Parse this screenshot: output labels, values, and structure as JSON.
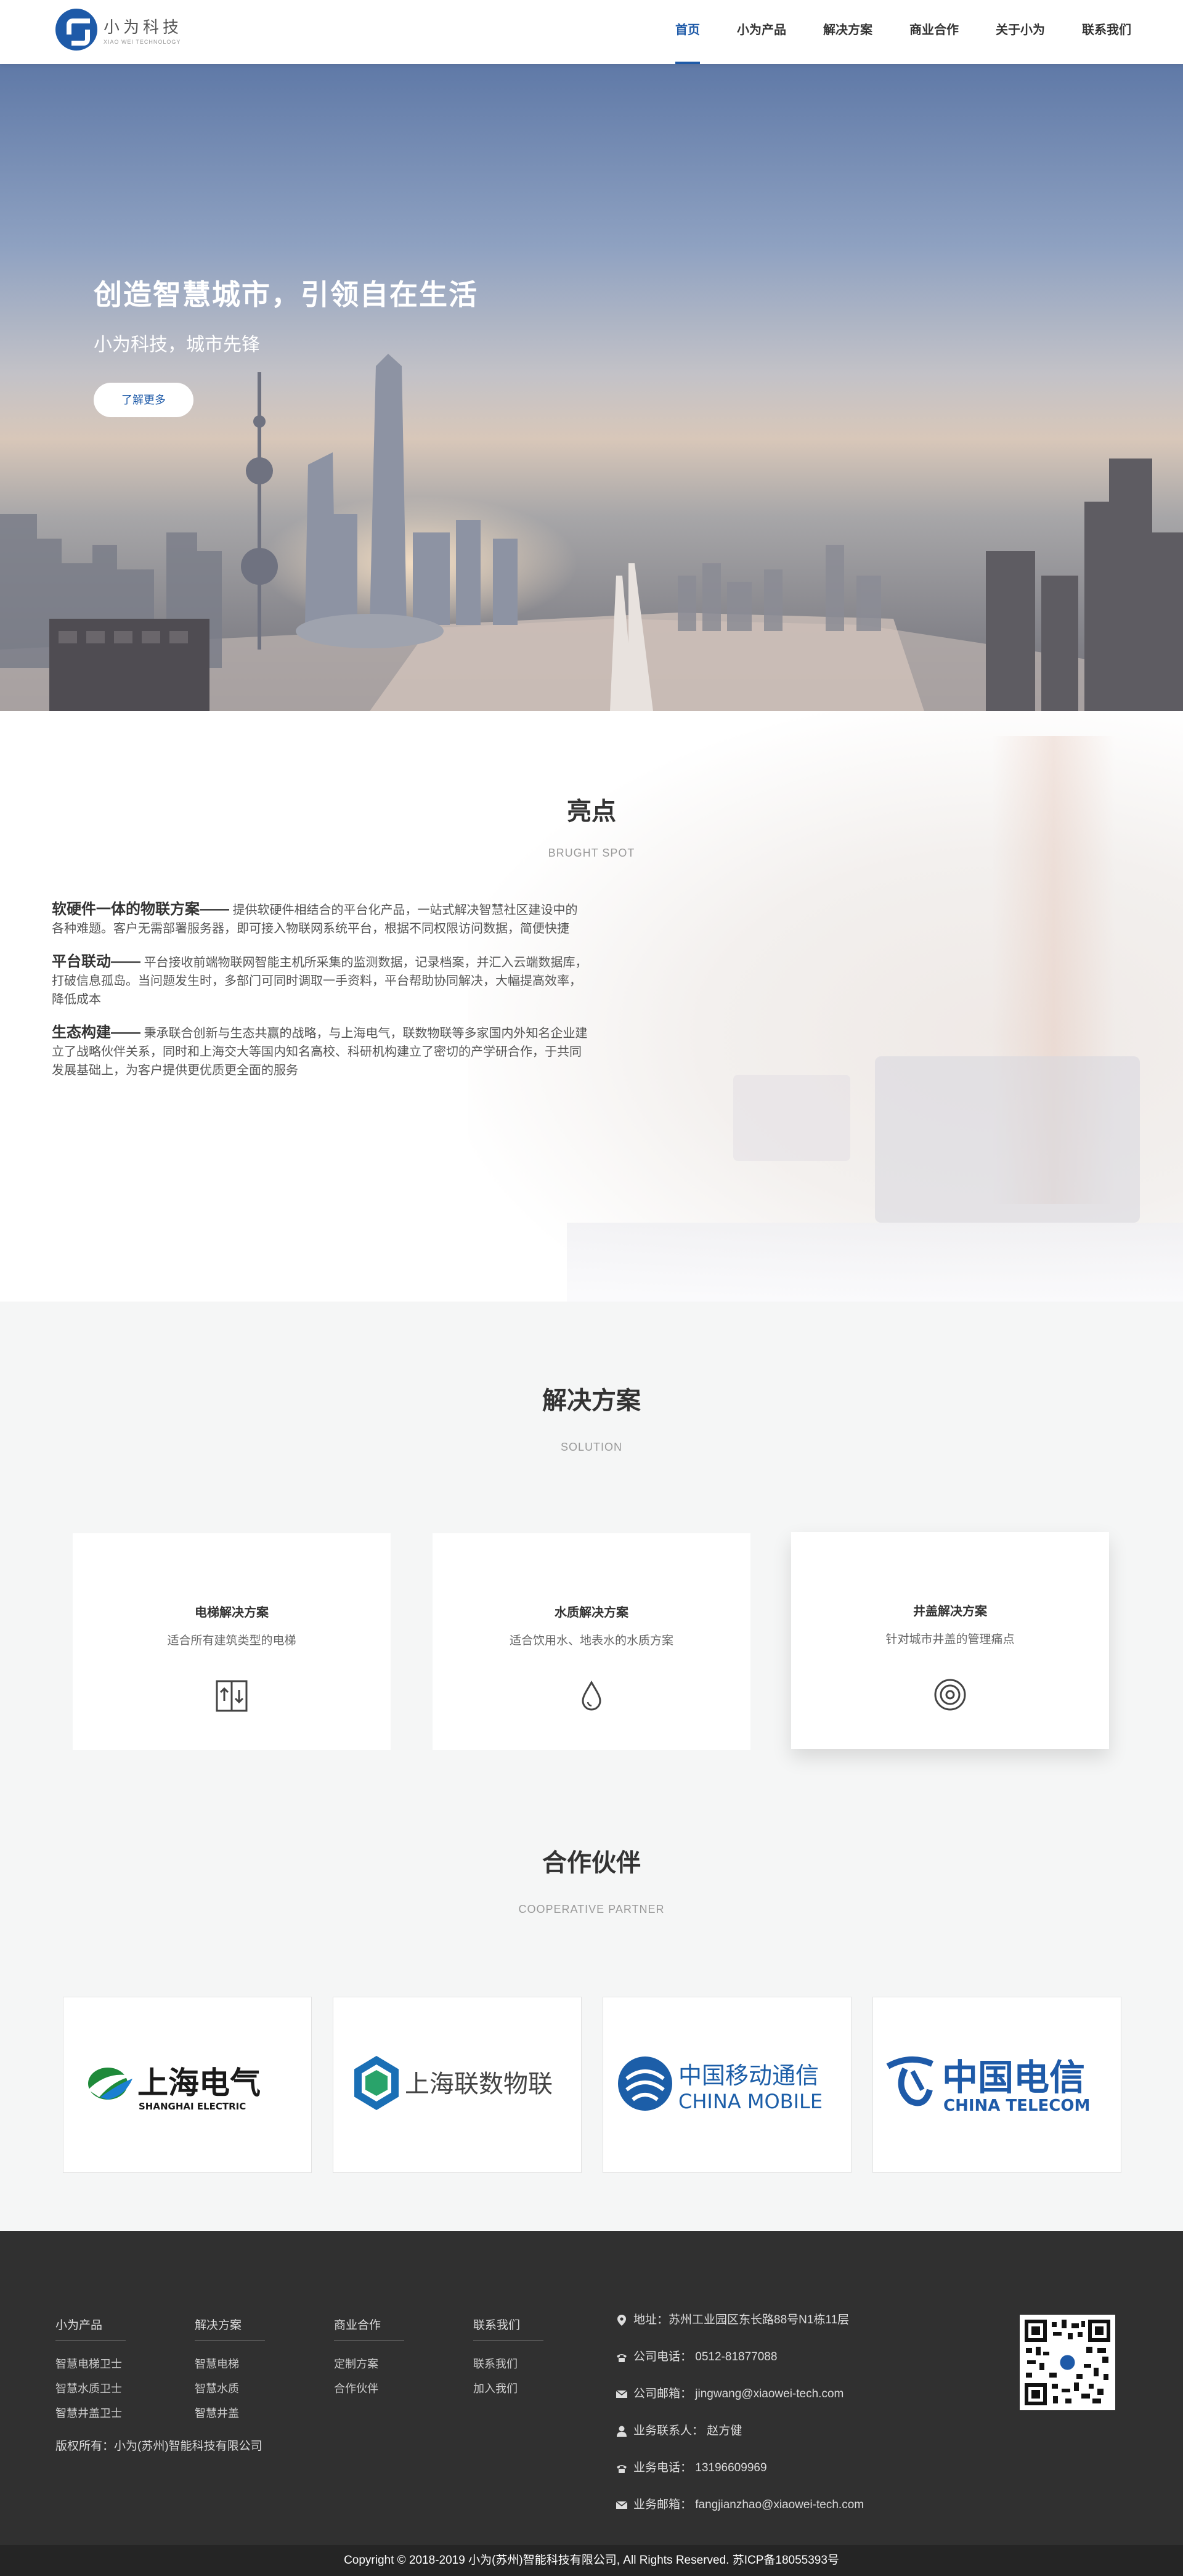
{
  "header": {
    "logo_cn": "小为科技",
    "logo_en": "XIAO WEI TECHNOLOGY",
    "nav": [
      "首页",
      "小为产品",
      "解决方案",
      "商业合作",
      "关于小为",
      "联系我们"
    ],
    "active_nav": "首页"
  },
  "hero": {
    "title": "创造智慧城市，引领自在生活",
    "subtitle": "小为科技，城市先锋",
    "button": "了解更多"
  },
  "highlights": {
    "title": "亮点",
    "subtitle": "BRUGHT SPOT",
    "items": [
      {
        "head": "软硬件一体的物联方案——",
        "text": "提供软硬件相结合的平台化产品，一站式解决智慧社区建设中的各种难题。客户无需部署服务器，即可接入物联网系统平台，根据不同权限访问数据，简便快捷"
      },
      {
        "head": "平台联动——",
        "text": "平台接收前端物联网智能主机所采集的监测数据，记录档案，并汇入云端数据库，打破信息孤岛。当问题发生时，多部门可同时调取一手资料，平台帮助协同解决，大幅提高效率，降低成本"
      },
      {
        "head": "生态构建——",
        "text": "秉承联合创新与生态共赢的战略，与上海电气，联数物联等多家国内外知名企业建立了战略伙伴关系，同时和上海交大等国内知名高校、科研机构建立了密切的产学研合作，于共同发展基础上，为客户提供更优质更全面的服务"
      }
    ]
  },
  "solutions": {
    "title": "解决方案",
    "subtitle": "SOLUTION",
    "cards": [
      {
        "name": "电梯解决方案",
        "desc": "适合所有建筑类型的电梯",
        "icon": "elevator-icon"
      },
      {
        "name": "水质解决方案",
        "desc": "适合饮用水、地表水的水质方案",
        "icon": "water-drop-icon"
      },
      {
        "name": "井盖解决方案",
        "desc": "针对城市井盖的管理痛点",
        "icon": "manhole-cover-icon"
      }
    ]
  },
  "partners": {
    "title": "合作伙伴",
    "subtitle": "COOPERATIVE PARTNER",
    "items": [
      {
        "cn": "上海电气",
        "en": "SHANGHAI ELECTRIC",
        "color": "#1a1a1a",
        "accent": "#1f8a3a"
      },
      {
        "cn": "上海联数物联",
        "en": "",
        "color": "#444444",
        "accent": "#1a6fb5"
      },
      {
        "cn": "中国移动通信",
        "en": "CHINA MOBILE",
        "color": "#1c5ea8",
        "accent": "#1c5ea8"
      },
      {
        "cn": "中国电信",
        "en": "CHINA TELECOM",
        "color": "#1e5aa8",
        "accent": "#1e5aa8"
      }
    ]
  },
  "footer": {
    "columns": [
      {
        "head": "小为产品",
        "links": [
          "智慧电梯卫士",
          "智慧水质卫士",
          "智慧井盖卫士"
        ]
      },
      {
        "head": "解决方案",
        "links": [
          "智慧电梯",
          "智慧水质",
          "智慧井盖"
        ]
      },
      {
        "head": "商业合作",
        "links": [
          "定制方案",
          "合作伙伴"
        ]
      },
      {
        "head": "联系我们",
        "links": [
          "联系我们",
          "加入我们"
        ]
      }
    ],
    "owner": "版权所有：小为(苏州)智能科技有限公司",
    "contact": [
      {
        "icon": "location-icon",
        "text": "地址：苏州工业园区东长路88号N1栋11层"
      },
      {
        "icon": "phone-icon",
        "text": "公司电话：  0512-81877088"
      },
      {
        "icon": "mail-icon",
        "text": "公司邮箱：  jingwang@xiaowei-tech.com"
      },
      {
        "icon": "user-icon",
        "text": "业务联系人：  赵方健"
      },
      {
        "icon": "phone-icon",
        "text": "业务电话：  13196609969"
      },
      {
        "icon": "mail-icon",
        "text": "业务邮箱：  fangjianzhao@xiaowei-tech.com"
      }
    ],
    "copyright": "Copyright © 2018-2019 小为(苏州)智能科技有限公司, All Rights Reserved.    苏ICP备18055393号"
  },
  "colors": {
    "brand": "#1e5aa8",
    "footer_bg": "#303030",
    "bottom_bar": "#252525",
    "section_bg": "#f5f6f6"
  }
}
